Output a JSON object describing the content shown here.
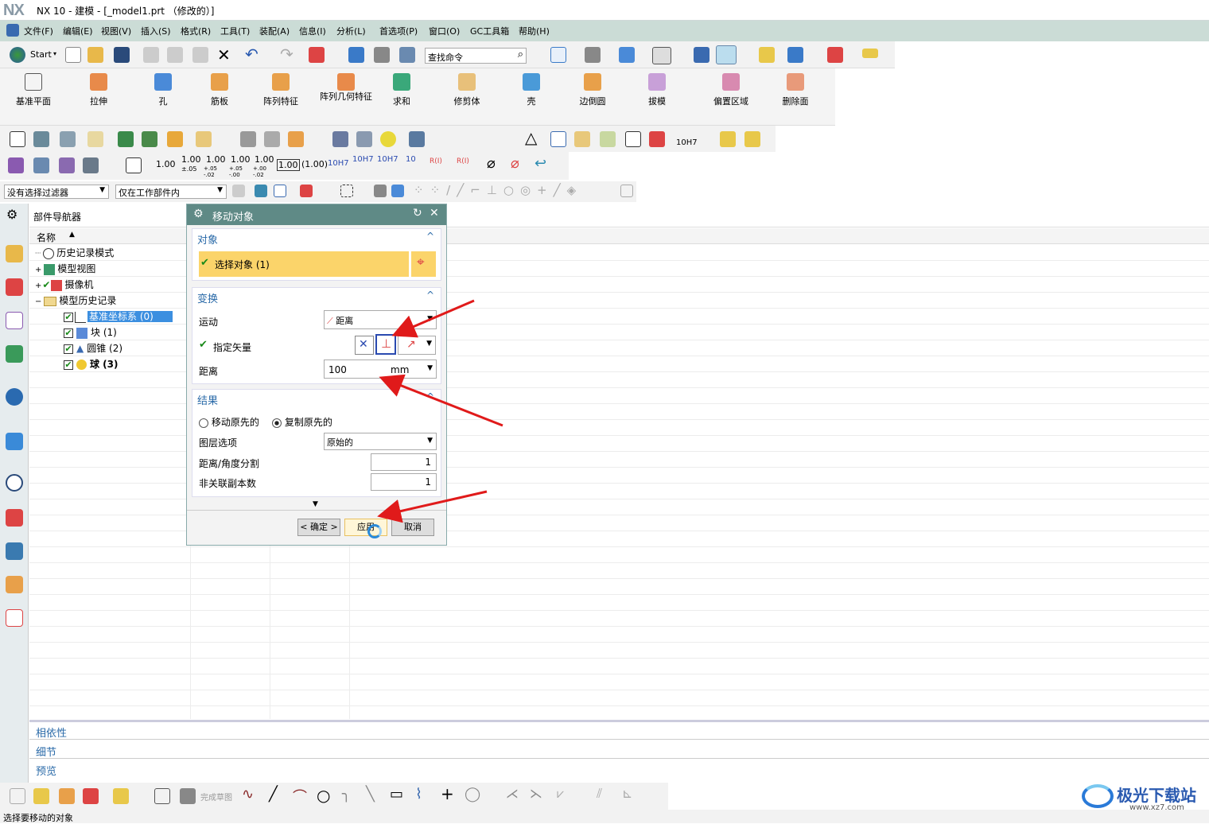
{
  "window": {
    "logo": "NX",
    "title": "NX 10 - 建模 - [_model1.prt （修改的）]"
  },
  "menu": [
    "文件(F)",
    "编辑(E)",
    "视图(V)",
    "插入(S)",
    "格式(R)",
    "工具(T)",
    "装配(A)",
    "信息(I)",
    "分析(L)",
    "首选项(P)",
    "窗口(O)",
    "GC工具箱",
    "帮助(H)"
  ],
  "toolbar": {
    "start_label": "Start",
    "search_placeholder": "查找命令"
  },
  "ribbon": [
    "基准平面",
    "拉伸",
    "孔",
    "筋板",
    "阵列特征",
    "阵列几何特征",
    "求和",
    "修剪体",
    "壳",
    "边倒圆",
    "拔模",
    "偏置区域",
    "删除面"
  ],
  "pmi": {
    "v1": "1.00",
    "v2": "1.00",
    "v2s": "±.05",
    "v3": "1.00",
    "v3s": "+.05 -.02",
    "v4": "1.00",
    "v4s": "+.05 -.00",
    "v5": "1.00",
    "v5s": "+.00 -.02",
    "v6": "1.00",
    "v7": "(1.00)",
    "v8": "10H7",
    "v9": "10H7",
    "v10": "10H7",
    "v11": "10",
    "r1": "R(I)",
    "r2": "R(I)",
    "fit": "10H7"
  },
  "filters": {
    "selection_filter": "没有选择过滤器",
    "scope": "仅在工作部件内"
  },
  "navigator": {
    "title": "部件导航器",
    "column": "名称",
    "items": [
      {
        "label": "历史记录模式"
      },
      {
        "label": "模型视图"
      },
      {
        "label": "摄像机"
      },
      {
        "label": "模型历史记录"
      },
      {
        "label": "基准坐标系 (0)"
      },
      {
        "label": "块 (1)"
      },
      {
        "label": "圆锥 (2)"
      },
      {
        "label": "球 (3)"
      }
    ]
  },
  "dialog": {
    "title": "移动对象",
    "object_section": "对象",
    "select_object": "选择对象 (1)",
    "transform_section": "变换",
    "motion_label": "运动",
    "motion_value": "距离",
    "vector_label": "指定矢量",
    "distance_label": "距离",
    "distance_value": "100",
    "distance_unit": "mm",
    "result_section": "结果",
    "radio_move": "移动原先的",
    "radio_copy": "复制原先的",
    "layer_label": "图层选项",
    "layer_value": "原始的",
    "split_label": "距离/角度分割",
    "split_value": "1",
    "copies_label": "非关联副本数",
    "copies_value": "1",
    "ok": "< 确定 >",
    "apply": "应用",
    "cancel": "取消"
  },
  "bottom_panels": [
    "相依性",
    "细节",
    "预览"
  ],
  "bottom_toolbar": {
    "finish_sketch": "完成草图"
  },
  "status": "选择要移动的对象",
  "watermark": {
    "name": "极光下载站",
    "url": "www.xz7.com"
  },
  "colors": {
    "menubar": "#cbdcd6",
    "dialog_header": "#5f8a86",
    "section_text": "#2a6aa8",
    "selected_row": "#3c8fe0",
    "highlight": "#fbd46a",
    "arrow": "#e01a1a"
  }
}
